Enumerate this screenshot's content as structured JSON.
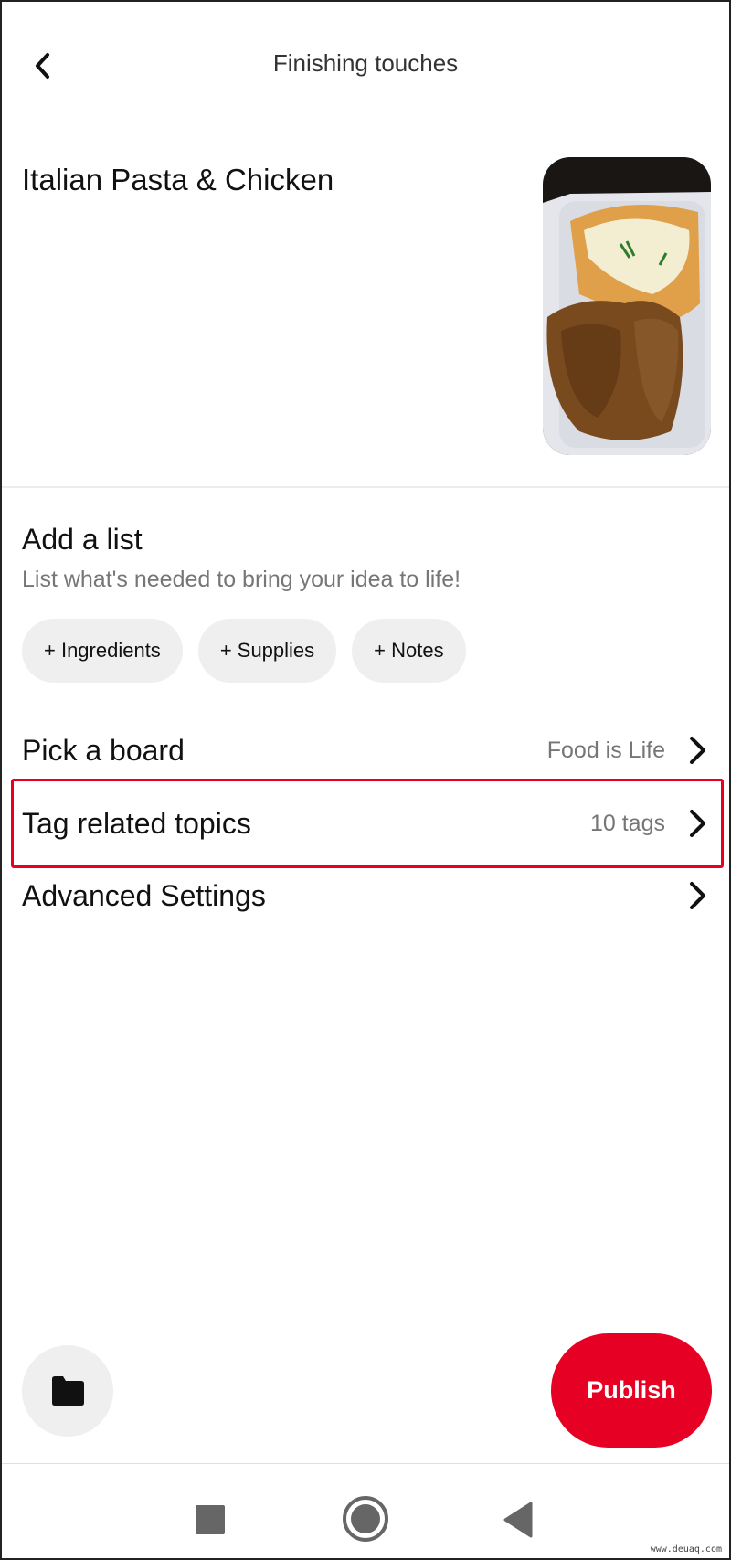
{
  "header": {
    "title": "Finishing touches",
    "back_icon": "chevron-left-icon"
  },
  "pin": {
    "title": "Italian Pasta & Chicken",
    "thumbnail_alt": "Pasta with cheese sauce and fried chicken in a foam box"
  },
  "add_list": {
    "title": "Add a list",
    "subtitle": "List what's needed to bring your idea to life!",
    "chips": [
      {
        "label": "+ Ingredients"
      },
      {
        "label": "+ Supplies"
      },
      {
        "label": "+ Notes"
      }
    ]
  },
  "settings_rows": [
    {
      "label": "Pick a board",
      "value": "Food is Life"
    },
    {
      "label": "Tag related topics",
      "value": "10 tags",
      "highlighted": true
    },
    {
      "label": "Advanced Settings",
      "value": ""
    }
  ],
  "footer": {
    "folder_icon": "folder-icon",
    "publish_label": "Publish"
  },
  "system_nav": {
    "items": [
      "recents-square-icon",
      "home-circle-icon",
      "back-triangle-icon"
    ]
  },
  "colors": {
    "accent": "#e60023",
    "highlight_box": "#e60023",
    "muted_text": "#767676",
    "chip_bg": "#efefef"
  },
  "watermark": "www.deuaq.com"
}
